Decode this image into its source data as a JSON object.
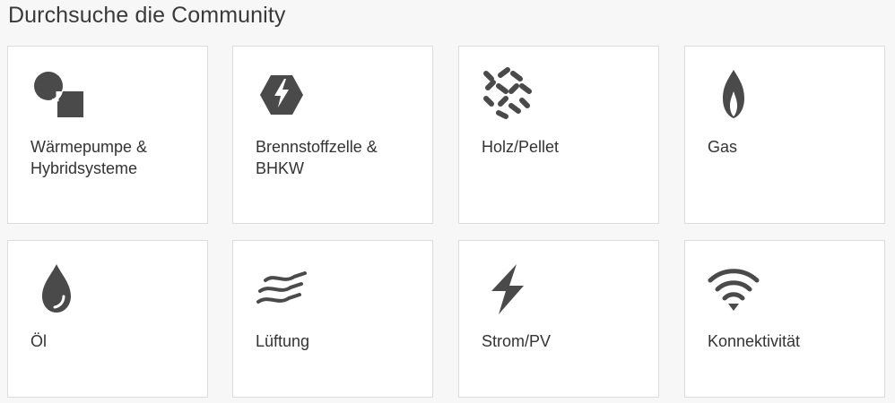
{
  "title": "Durchsuche die Community",
  "colors": {
    "icon": "#4a4a4a",
    "card_background": "#ffffff",
    "card_border": "#dcdcdc",
    "page_background": "#f7f7f7",
    "text": "#333333"
  },
  "categories": [
    {
      "label": "Wärmepumpe & Hybridsysteme",
      "icon": "heat-pump-icon"
    },
    {
      "label": "Brennstoffzelle & BHKW",
      "icon": "fuel-cell-icon"
    },
    {
      "label": "Holz/Pellet",
      "icon": "wood-pellet-icon"
    },
    {
      "label": "Gas",
      "icon": "gas-flame-icon"
    },
    {
      "label": "Öl",
      "icon": "oil-drop-icon"
    },
    {
      "label": "Lüftung",
      "icon": "ventilation-icon"
    },
    {
      "label": "Strom/PV",
      "icon": "lightning-icon"
    },
    {
      "label": "Konnektivität",
      "icon": "wifi-icon"
    }
  ]
}
